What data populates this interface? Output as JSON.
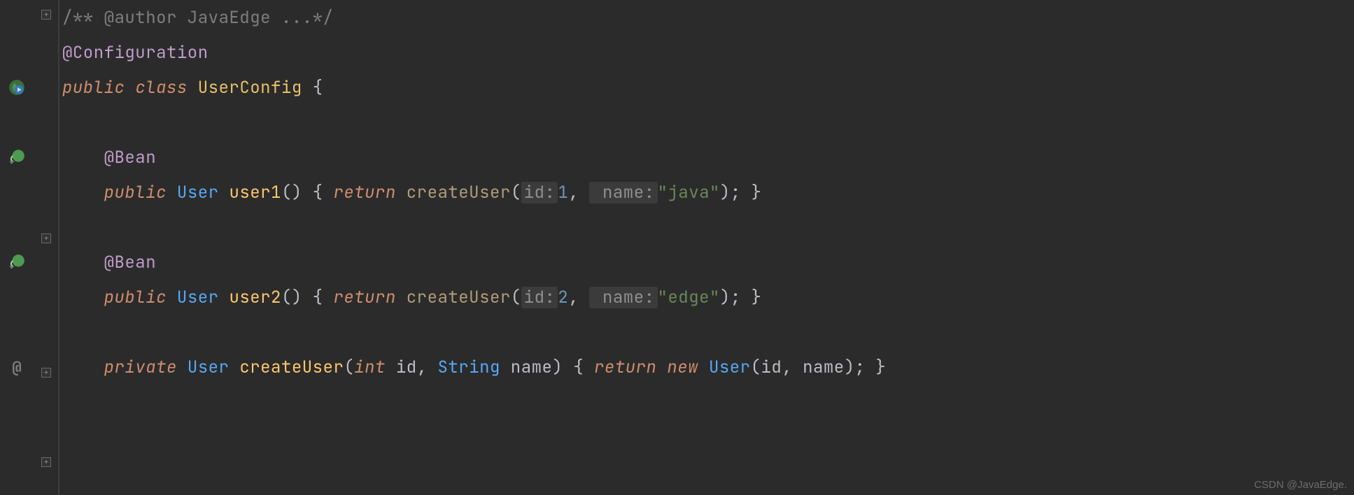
{
  "watermark": "CSDN @JavaEdge.",
  "code": {
    "line1": {
      "comment": "/** @author JavaEdge ...*/"
    },
    "line2": {
      "annotation": "@Configuration"
    },
    "line3": {
      "kw_public": "public",
      "kw_class": "class",
      "class_name": "UserConfig",
      "brace": " {"
    },
    "line5": {
      "annotation": "@Bean"
    },
    "line6": {
      "kw_public": "public",
      "type": "User",
      "method": "user1",
      "parens": "()",
      "brace_open": " { ",
      "kw_return": "return",
      "call": "createUser",
      "paren_open": "(",
      "hint_id": "id:",
      "arg_id": "1",
      "comma": ", ",
      "hint_name": " name:",
      "arg_name": "\"java\"",
      "paren_close": ")",
      "semi": "; ",
      "brace_close": "}"
    },
    "line8": {
      "annotation": "@Bean"
    },
    "line9": {
      "kw_public": "public",
      "type": "User",
      "method": "user2",
      "parens": "()",
      "brace_open": " { ",
      "kw_return": "return",
      "call": "createUser",
      "paren_open": "(",
      "hint_id": "id:",
      "arg_id": "2",
      "comma": ", ",
      "hint_name": " name:",
      "arg_name": "\"edge\"",
      "paren_close": ")",
      "semi": "; ",
      "brace_close": "}"
    },
    "line11": {
      "kw_private": "private",
      "type": "User",
      "method": "createUser",
      "paren_open": "(",
      "ptype1": "int",
      "pname1": "id",
      "comma1": ", ",
      "ptype2": "String",
      "pname2": "name",
      "paren_close": ")",
      "brace_open": " { ",
      "kw_return": "return",
      "kw_new": "new",
      "ctor": "User",
      "cparen_open": "(",
      "carg1": "id",
      "ccomma": ", ",
      "carg2": "name",
      "cparen_close": ")",
      "semi": "; ",
      "brace_close": "}"
    }
  },
  "gutter": {
    "at_sign": "@"
  }
}
